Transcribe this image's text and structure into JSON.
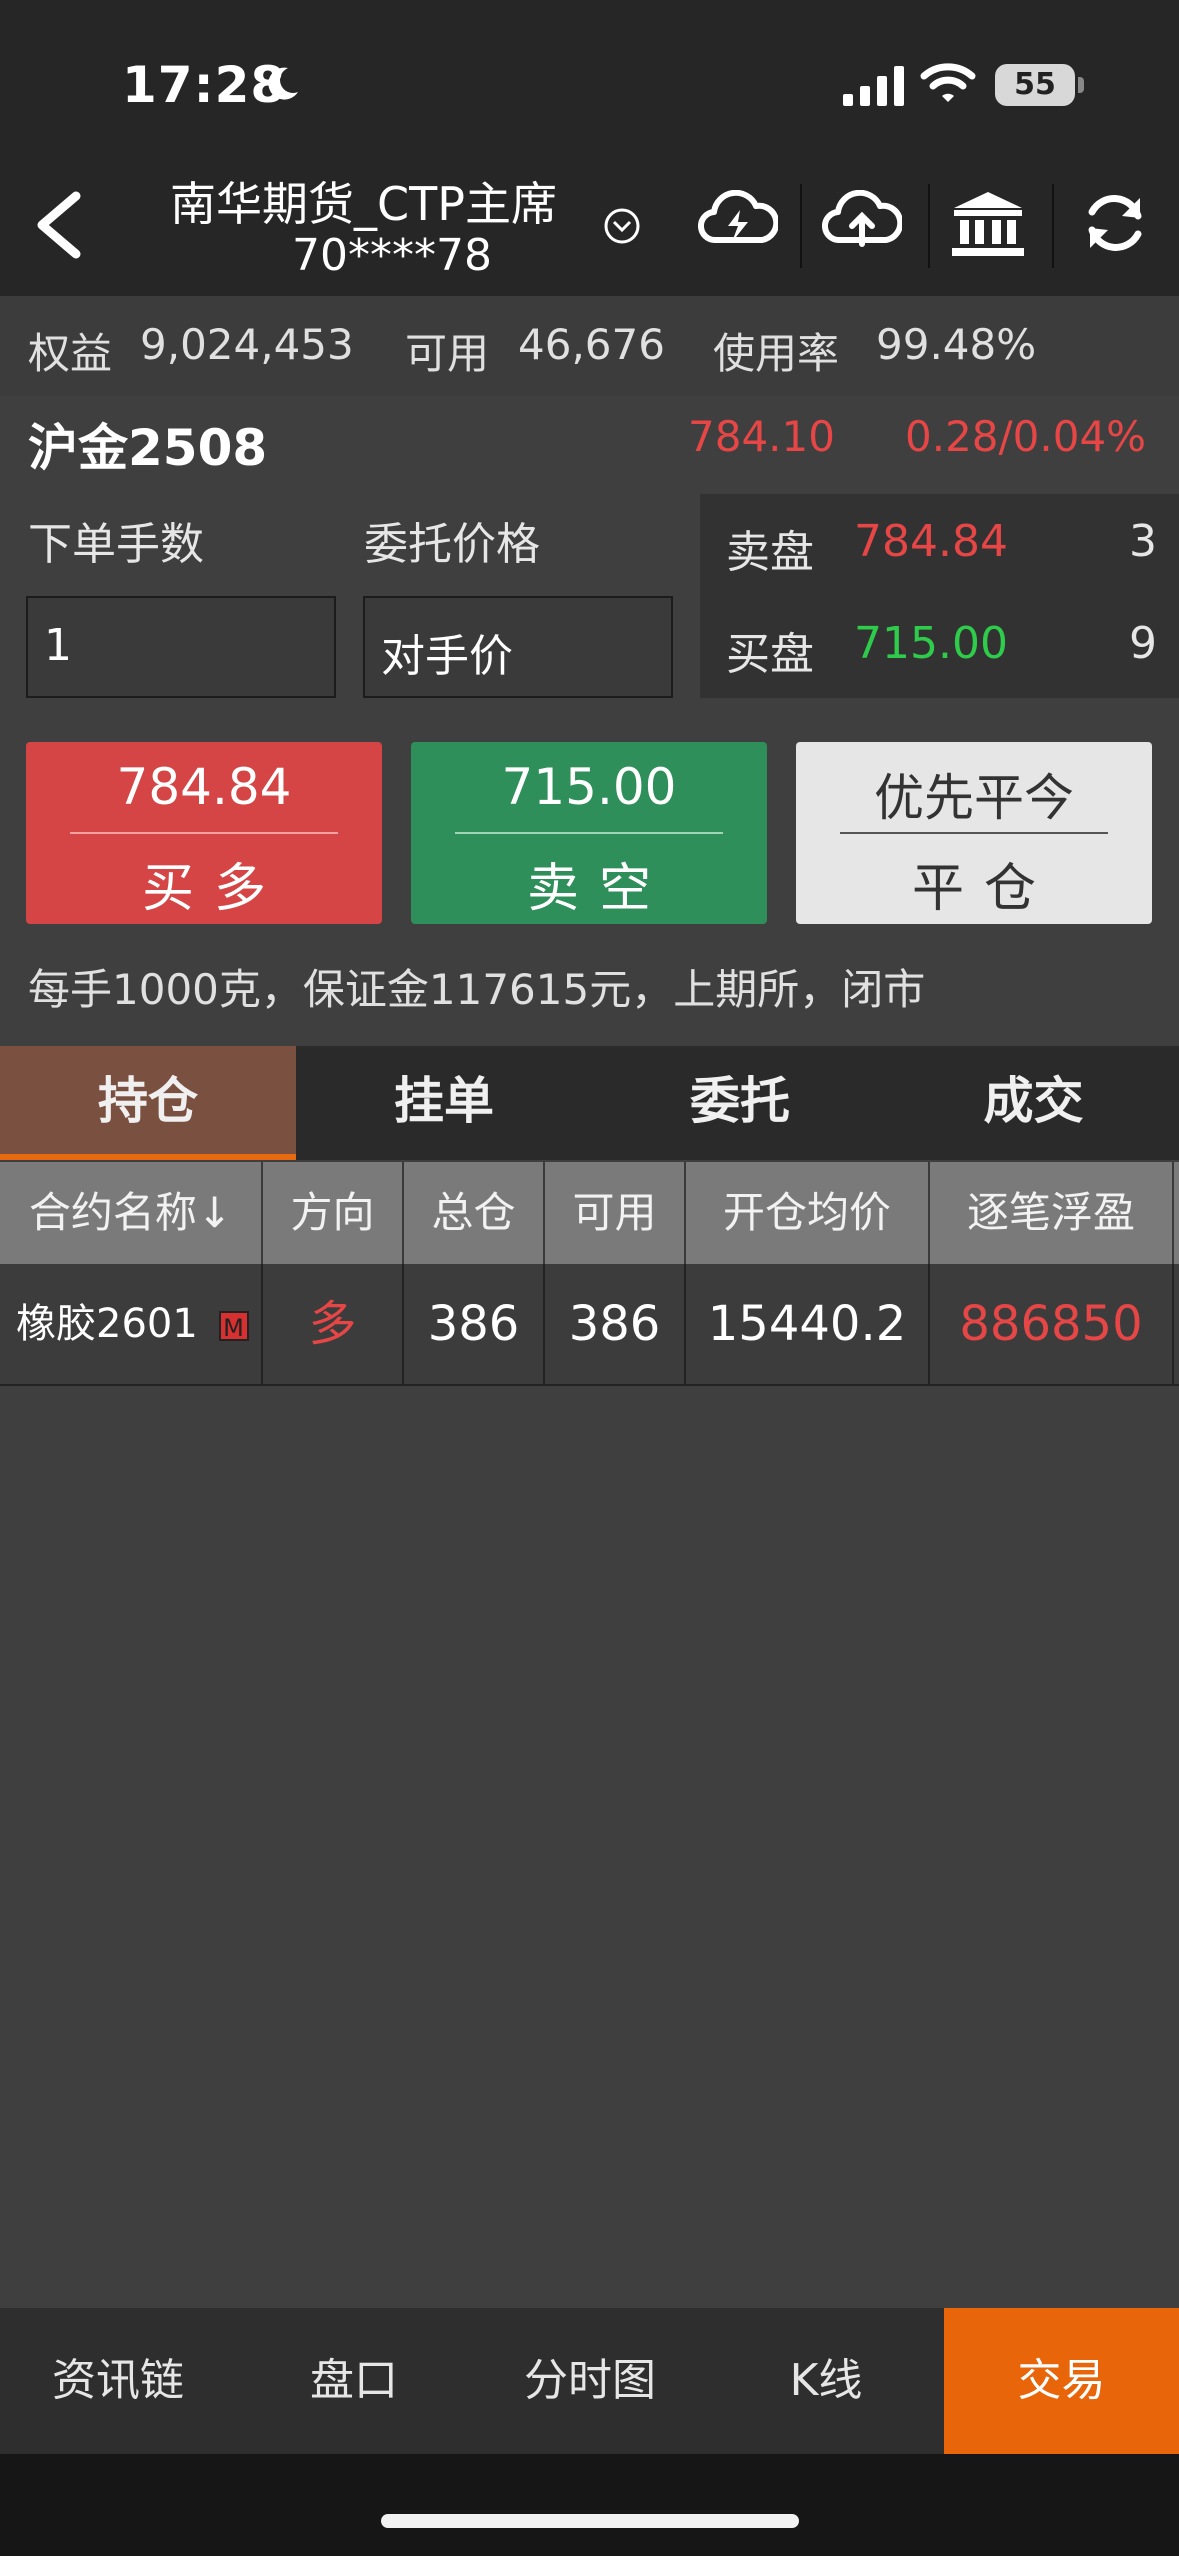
{
  "status": {
    "time": "17:28",
    "battery": "55"
  },
  "header": {
    "broker": "南华期货_CTP主席",
    "account": "70****78"
  },
  "account_bar": {
    "equity_label": "权益",
    "equity": "9,024,453",
    "available_label": "可用",
    "available": "46,676",
    "usage_label": "使用率",
    "usage": "99.48%"
  },
  "instrument": {
    "name": "沪金2508",
    "price": "784.10",
    "change": "0.28/0.04%"
  },
  "order": {
    "qty_label": "下单手数",
    "price_label": "委托价格",
    "qty_value": "1",
    "price_value": "对手价"
  },
  "book": {
    "ask_label": "卖盘",
    "ask_price": "784.84",
    "ask_vol": "3",
    "bid_label": "买盘",
    "bid_price": "715.00",
    "bid_vol": "9"
  },
  "buttons": {
    "buy_price": "784.84",
    "buy_label": "买多",
    "sell_price": "715.00",
    "sell_label": "卖空",
    "close_top": "优先平今",
    "close_label": "平仓"
  },
  "spec": "每手1000克，保证金117615元，上期所，闭市",
  "tabs": [
    "持仓",
    "挂单",
    "委托",
    "成交"
  ],
  "table": {
    "headers": [
      "合约名称↓",
      "方向",
      "总仓",
      "可用",
      "开仓均价",
      "逐笔浮盈"
    ],
    "rows": [
      {
        "name": "橡胶2601",
        "badge": "M",
        "direction": "多",
        "total": "386",
        "available": "386",
        "avg_price": "15440.2",
        "pnl": "886850"
      }
    ]
  },
  "bottom_nav": [
    "资讯链",
    "盘口",
    "分时图",
    "K线",
    "交易"
  ],
  "colors": {
    "red": "#e64646",
    "green": "#2ecc4a",
    "buy_bg": "#d64545",
    "sell_bg": "#2f8f5b",
    "accent": "#e8650a"
  }
}
